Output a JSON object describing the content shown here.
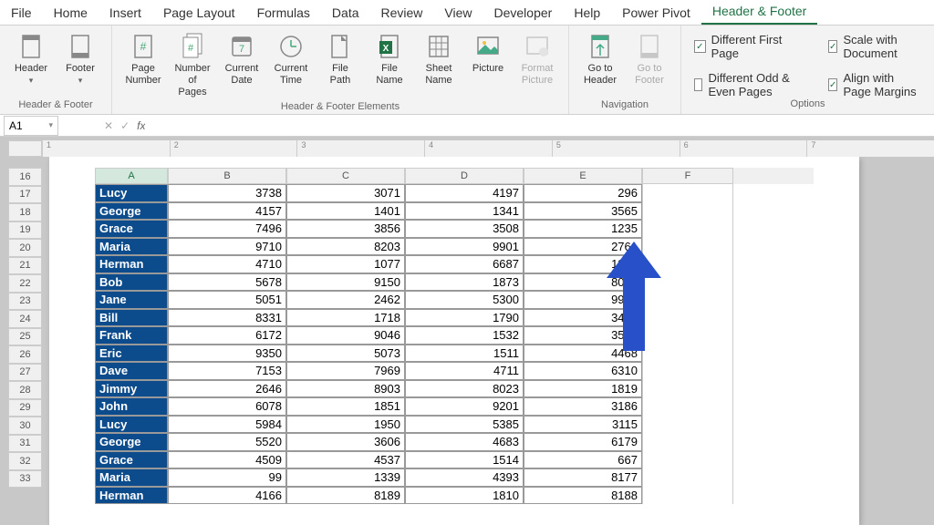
{
  "tabs": {
    "file": "File",
    "home": "Home",
    "insert": "Insert",
    "page_layout": "Page Layout",
    "formulas": "Formulas",
    "data": "Data",
    "review": "Review",
    "view": "View",
    "developer": "Developer",
    "help": "Help",
    "power_pivot": "Power Pivot",
    "header_footer": "Header & Footer"
  },
  "ribbon": {
    "groups": {
      "header_footer": "Header & Footer",
      "elements": "Header & Footer Elements",
      "navigation": "Navigation",
      "options": "Options"
    },
    "buttons": {
      "header": "Header",
      "footer": "Footer",
      "page_number": "Page Number",
      "number_of_pages": "Number of Pages",
      "current_date": "Current Date",
      "current_time": "Current Time",
      "file_path": "File Path",
      "file_name": "File Name",
      "sheet_name": "Sheet Name",
      "picture": "Picture",
      "format_picture": "Format Picture",
      "go_to_header": "Go to Header",
      "go_to_footer": "Go to Footer"
    },
    "options": {
      "diff_first": "Different First Page",
      "diff_odd_even": "Different Odd & Even Pages",
      "scale_doc": "Scale with Document",
      "align_margins": "Align with Page Margins"
    }
  },
  "name_box": "A1",
  "columns": [
    "A",
    "B",
    "C",
    "D",
    "E",
    "F"
  ],
  "ruler_labels": [
    "1",
    "2",
    "3",
    "4",
    "5",
    "6",
    "7"
  ],
  "row_start": 16,
  "rows": [
    {
      "n": "Lucy",
      "v": [
        3738,
        3071,
        4197,
        "296"
      ]
    },
    {
      "n": "George",
      "v": [
        4157,
        1401,
        1341,
        3565
      ]
    },
    {
      "n": "Grace",
      "v": [
        7496,
        3856,
        3508,
        1235
      ]
    },
    {
      "n": "Maria",
      "v": [
        9710,
        8203,
        9901,
        2761
      ]
    },
    {
      "n": "Herman",
      "v": [
        4710,
        1077,
        6687,
        1823
      ]
    },
    {
      "n": "Bob",
      "v": [
        5678,
        9150,
        1873,
        8062
      ]
    },
    {
      "n": "Jane",
      "v": [
        5051,
        2462,
        5300,
        9918
      ]
    },
    {
      "n": "Bill",
      "v": [
        8331,
        1718,
        1790,
        3427
      ]
    },
    {
      "n": "Frank",
      "v": [
        6172,
        9046,
        1532,
        3545
      ]
    },
    {
      "n": "Eric",
      "v": [
        9350,
        5073,
        1511,
        4468
      ]
    },
    {
      "n": "Dave",
      "v": [
        7153,
        7969,
        4711,
        6310
      ]
    },
    {
      "n": "Jimmy",
      "v": [
        2646,
        8903,
        8023,
        1819
      ]
    },
    {
      "n": "John",
      "v": [
        6078,
        1851,
        9201,
        3186
      ]
    },
    {
      "n": "Lucy",
      "v": [
        5984,
        1950,
        5385,
        3115
      ]
    },
    {
      "n": "George",
      "v": [
        5520,
        3606,
        4683,
        6179
      ]
    },
    {
      "n": "Grace",
      "v": [
        4509,
        4537,
        1514,
        667
      ]
    },
    {
      "n": "Maria",
      "v": [
        99,
        1339,
        4393,
        8177
      ]
    },
    {
      "n": "Herman",
      "v": [
        4166,
        8189,
        1810,
        8188
      ]
    }
  ],
  "checkbox_states": {
    "diff_first": true,
    "diff_odd_even": false,
    "scale_doc": true,
    "align_margins": true
  }
}
